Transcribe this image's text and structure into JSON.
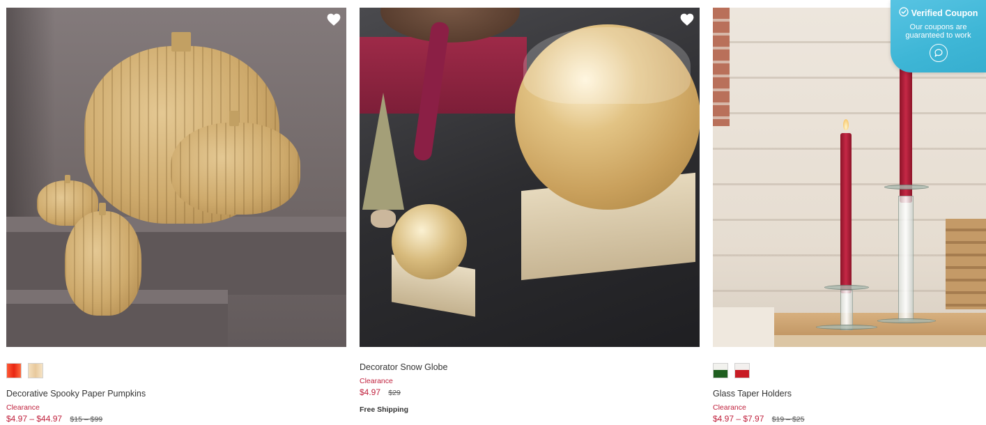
{
  "products": [
    {
      "title": "Decorative Spooky Paper Pumpkins",
      "badge": "Clearance",
      "sale_price": "$4.97 – $44.97",
      "original_price": "$15 – $99",
      "swatches": [
        "red",
        "cream"
      ],
      "wishlist_icon": "heart-icon"
    },
    {
      "title": "Decorator Snow Globe",
      "badge": "Clearance",
      "sale_price": "$4.97",
      "original_price": "$29",
      "shipping": "Free Shipping",
      "wishlist_icon": "heart-icon"
    },
    {
      "title": "Glass Taper Holders",
      "badge": "Clearance",
      "sale_price": "$4.97 – $7.97",
      "original_price": "$19 – $25",
      "swatches": [
        "green",
        "red"
      ]
    }
  ],
  "coupon": {
    "title": "Verified Coupon",
    "subtitle": "Our coupons are guaranteed to work",
    "check_icon": "check-circle-icon",
    "chat_icon": "chat-icon"
  },
  "colors": {
    "sale_red": "#c0213d",
    "coupon_blue": "#3eb6d6"
  }
}
